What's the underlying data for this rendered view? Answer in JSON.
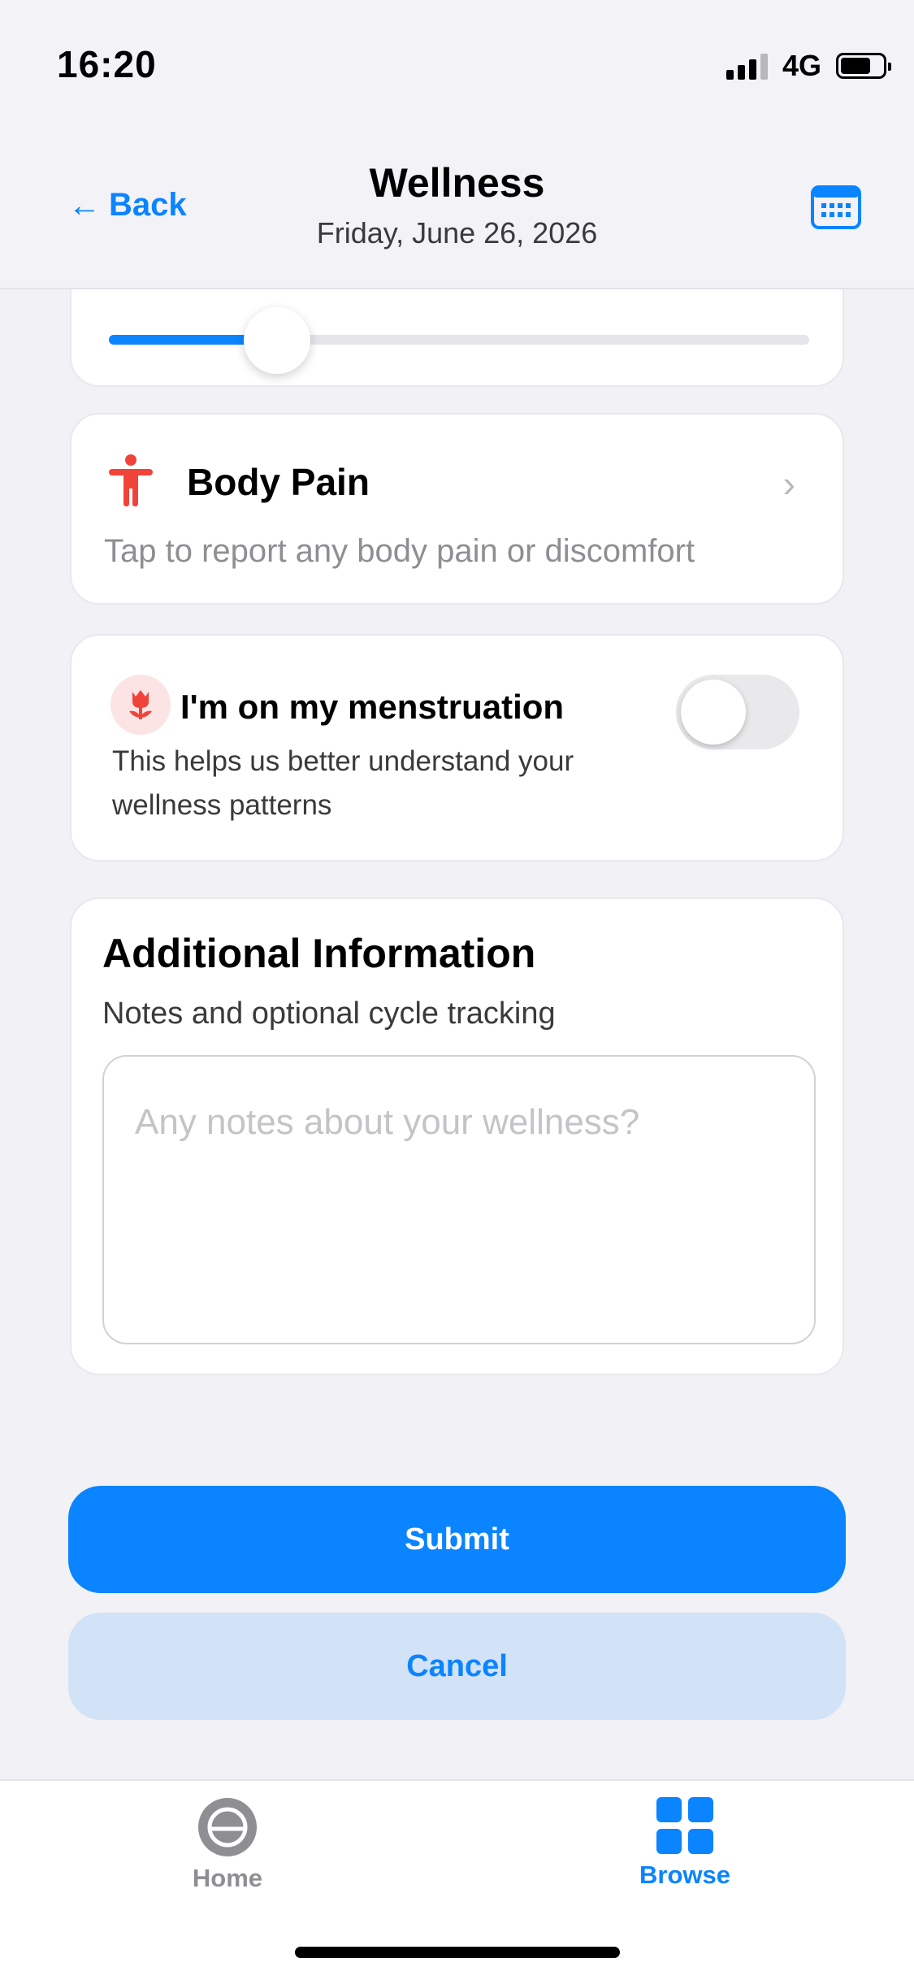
{
  "status_bar": {
    "time": "16:20",
    "network": "4G"
  },
  "nav": {
    "back_label": "Back",
    "title": "Wellness",
    "date": "Friday, June 26, 2026"
  },
  "slider": {
    "value_fraction": 0.24
  },
  "body_pain": {
    "title": "Body Pain",
    "subtitle": "Tap to report any body pain or discomfort"
  },
  "menstruation": {
    "title": "I'm on my menstruation",
    "subtitle": "This helps us better understand your wellness patterns",
    "toggle_on": false
  },
  "additional_info": {
    "title": "Additional Information",
    "subtitle": "Notes and optional cycle tracking",
    "notes_placeholder": "Any notes about your wellness?",
    "notes_value": ""
  },
  "actions": {
    "submit_label": "Submit",
    "cancel_label": "Cancel"
  },
  "tabbar": {
    "items": [
      {
        "label": "Home",
        "icon": "home-circle-icon",
        "active": false
      },
      {
        "label": "Browse",
        "icon": "grid-icon",
        "active": true
      }
    ]
  },
  "colors": {
    "accent": "#0a84ff",
    "danger": "#f0433a",
    "background": "#f1f1f6"
  }
}
